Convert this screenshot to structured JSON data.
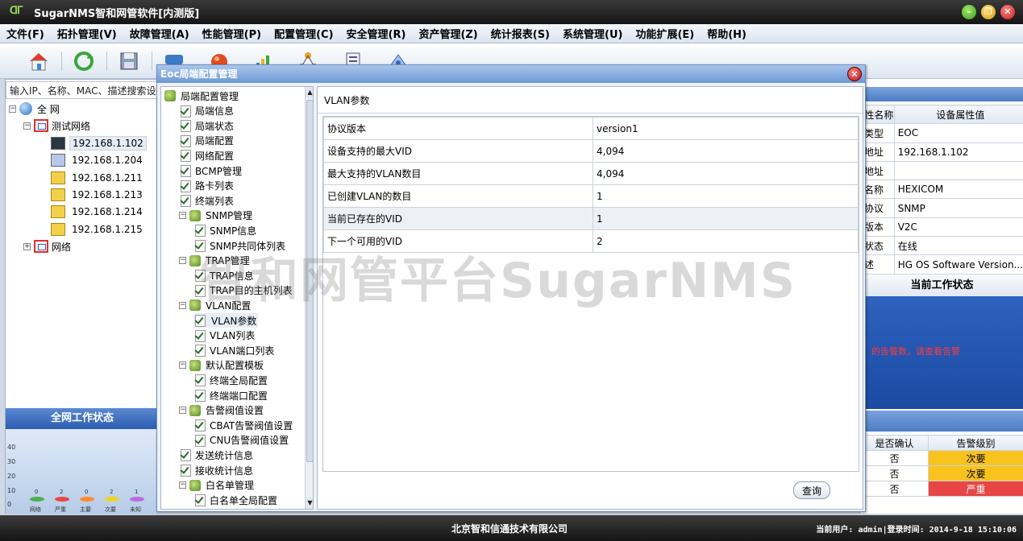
{
  "window": {
    "title": "SugarNMS智和网管软件[内测版]",
    "logo_text": "ᗡᒥ"
  },
  "menu": {
    "items": [
      "文件(F)",
      "拓扑管理(V)",
      "故障管理(A)",
      "性能管理(P)",
      "配置管理(C)",
      "安全管理(R)",
      "资产管理(Z)",
      "统计报表(S)",
      "系统管理(U)",
      "功能扩展(E)",
      "帮助(H)"
    ]
  },
  "search": {
    "value": "输入IP、名称、MAC、描述搜索设备"
  },
  "topology": {
    "root": "全 网",
    "group1": "测试网络",
    "devices": [
      "192.168.1.102",
      "192.168.1.204",
      "192.168.1.211",
      "192.168.1.213",
      "192.168.1.214",
      "192.168.1.215"
    ],
    "group2": "网络"
  },
  "net_status": {
    "title": "全网工作状态",
    "yticks": [
      "40",
      "30",
      "20",
      "10",
      "0"
    ],
    "bars": [
      {
        "label": "网络",
        "value": "0",
        "color": "#4caf50"
      },
      {
        "label": "严重",
        "value": "2",
        "color": "#e84545"
      },
      {
        "label": "主要",
        "value": "0",
        "color": "#ff8a2b"
      },
      {
        "label": "次要",
        "value": "2",
        "color": "#f5d21c"
      },
      {
        "label": "未知",
        "value": "1",
        "color": "#b56cdf"
      }
    ]
  },
  "device_attrs": {
    "header": [
      "性名称",
      "设备属性值"
    ],
    "rows": [
      [
        "类型",
        "EOC"
      ],
      [
        "地址",
        "192.168.1.102"
      ],
      [
        "地址",
        ""
      ],
      [
        "名称",
        "HEXICOM"
      ],
      [
        "协议",
        "SNMP"
      ],
      [
        "版本",
        "V2C"
      ],
      [
        "状态",
        "在线"
      ],
      [
        "述",
        "HG OS Software Version..."
      ]
    ]
  },
  "current_status": {
    "title": "当前工作状态",
    "message": "的告警数，请查看告警"
  },
  "alarms": {
    "header": [
      "是否确认",
      "告警级别"
    ],
    "rows": [
      {
        "ack": "否",
        "level": "次要",
        "level_class": "lvl-minor"
      },
      {
        "ack": "否",
        "level": "次要",
        "level_class": "lvl-minor"
      },
      {
        "ack": "否",
        "level": "严重",
        "level_class": "lvl-major"
      }
    ]
  },
  "statusbar": {
    "company": "北京智和信通技术有限公司",
    "info": "当前用户: admin|登录时间: 2014-9-18 15:10:06"
  },
  "dialog": {
    "title": "Eoc局端配置管理",
    "section_title": "VLAN参数",
    "query_label": "查询",
    "tree": [
      {
        "label": "局端配置管理",
        "type": "folder",
        "level": 0
      },
      {
        "label": "局端信息",
        "type": "leaf",
        "level": 1
      },
      {
        "label": "局端状态",
        "type": "leaf",
        "level": 1
      },
      {
        "label": "局端配置",
        "type": "leaf",
        "level": 1
      },
      {
        "label": "网络配置",
        "type": "leaf",
        "level": 1
      },
      {
        "label": "BCMP管理",
        "type": "leaf",
        "level": 1
      },
      {
        "label": "路卡列表",
        "type": "leaf",
        "level": 1
      },
      {
        "label": "终端列表",
        "type": "leaf",
        "level": 1
      },
      {
        "label": "SNMP管理",
        "type": "folder",
        "level": 1
      },
      {
        "label": "SNMP信息",
        "type": "leaf",
        "level": 2
      },
      {
        "label": "SNMP共同体列表",
        "type": "leaf",
        "level": 2
      },
      {
        "label": "TRAP管理",
        "type": "folder",
        "level": 1
      },
      {
        "label": "TRAP信息",
        "type": "leaf",
        "level": 2
      },
      {
        "label": "TRAP目的主机列表",
        "type": "leaf",
        "level": 2
      },
      {
        "label": "VLAN配置",
        "type": "folder",
        "level": 1
      },
      {
        "label": "VLAN参数",
        "type": "leaf",
        "level": 2,
        "selected": true
      },
      {
        "label": "VLAN列表",
        "type": "leaf",
        "level": 2
      },
      {
        "label": "VLAN端口列表",
        "type": "leaf",
        "level": 2
      },
      {
        "label": "默认配置模板",
        "type": "folder",
        "level": 1
      },
      {
        "label": "终端全局配置",
        "type": "leaf",
        "level": 2
      },
      {
        "label": "终端端口配置",
        "type": "leaf",
        "level": 2
      },
      {
        "label": "告警阀值设置",
        "type": "folder",
        "level": 1
      },
      {
        "label": "CBAT告警阀值设置",
        "type": "leaf",
        "level": 2
      },
      {
        "label": "CNU告警阀值设置",
        "type": "leaf",
        "level": 2
      },
      {
        "label": "发送统计信息",
        "type": "leaf",
        "level": 1
      },
      {
        "label": "接收统计信息",
        "type": "leaf",
        "level": 1
      },
      {
        "label": "白名单管理",
        "type": "folder",
        "level": 1
      },
      {
        "label": "白名单全局配置",
        "type": "leaf",
        "level": 2
      }
    ],
    "params": [
      [
        "协议版本",
        "version1"
      ],
      [
        "设备支持的最大VID",
        "4,094"
      ],
      [
        "最大支持的VLAN数目",
        "4,094"
      ],
      [
        "已创建VLAN的数目",
        "1"
      ],
      [
        "当前已存在的VID",
        "1"
      ],
      [
        "下一个可用的VID",
        "2"
      ]
    ]
  },
  "watermark": "智和网管平台SugarNMS"
}
